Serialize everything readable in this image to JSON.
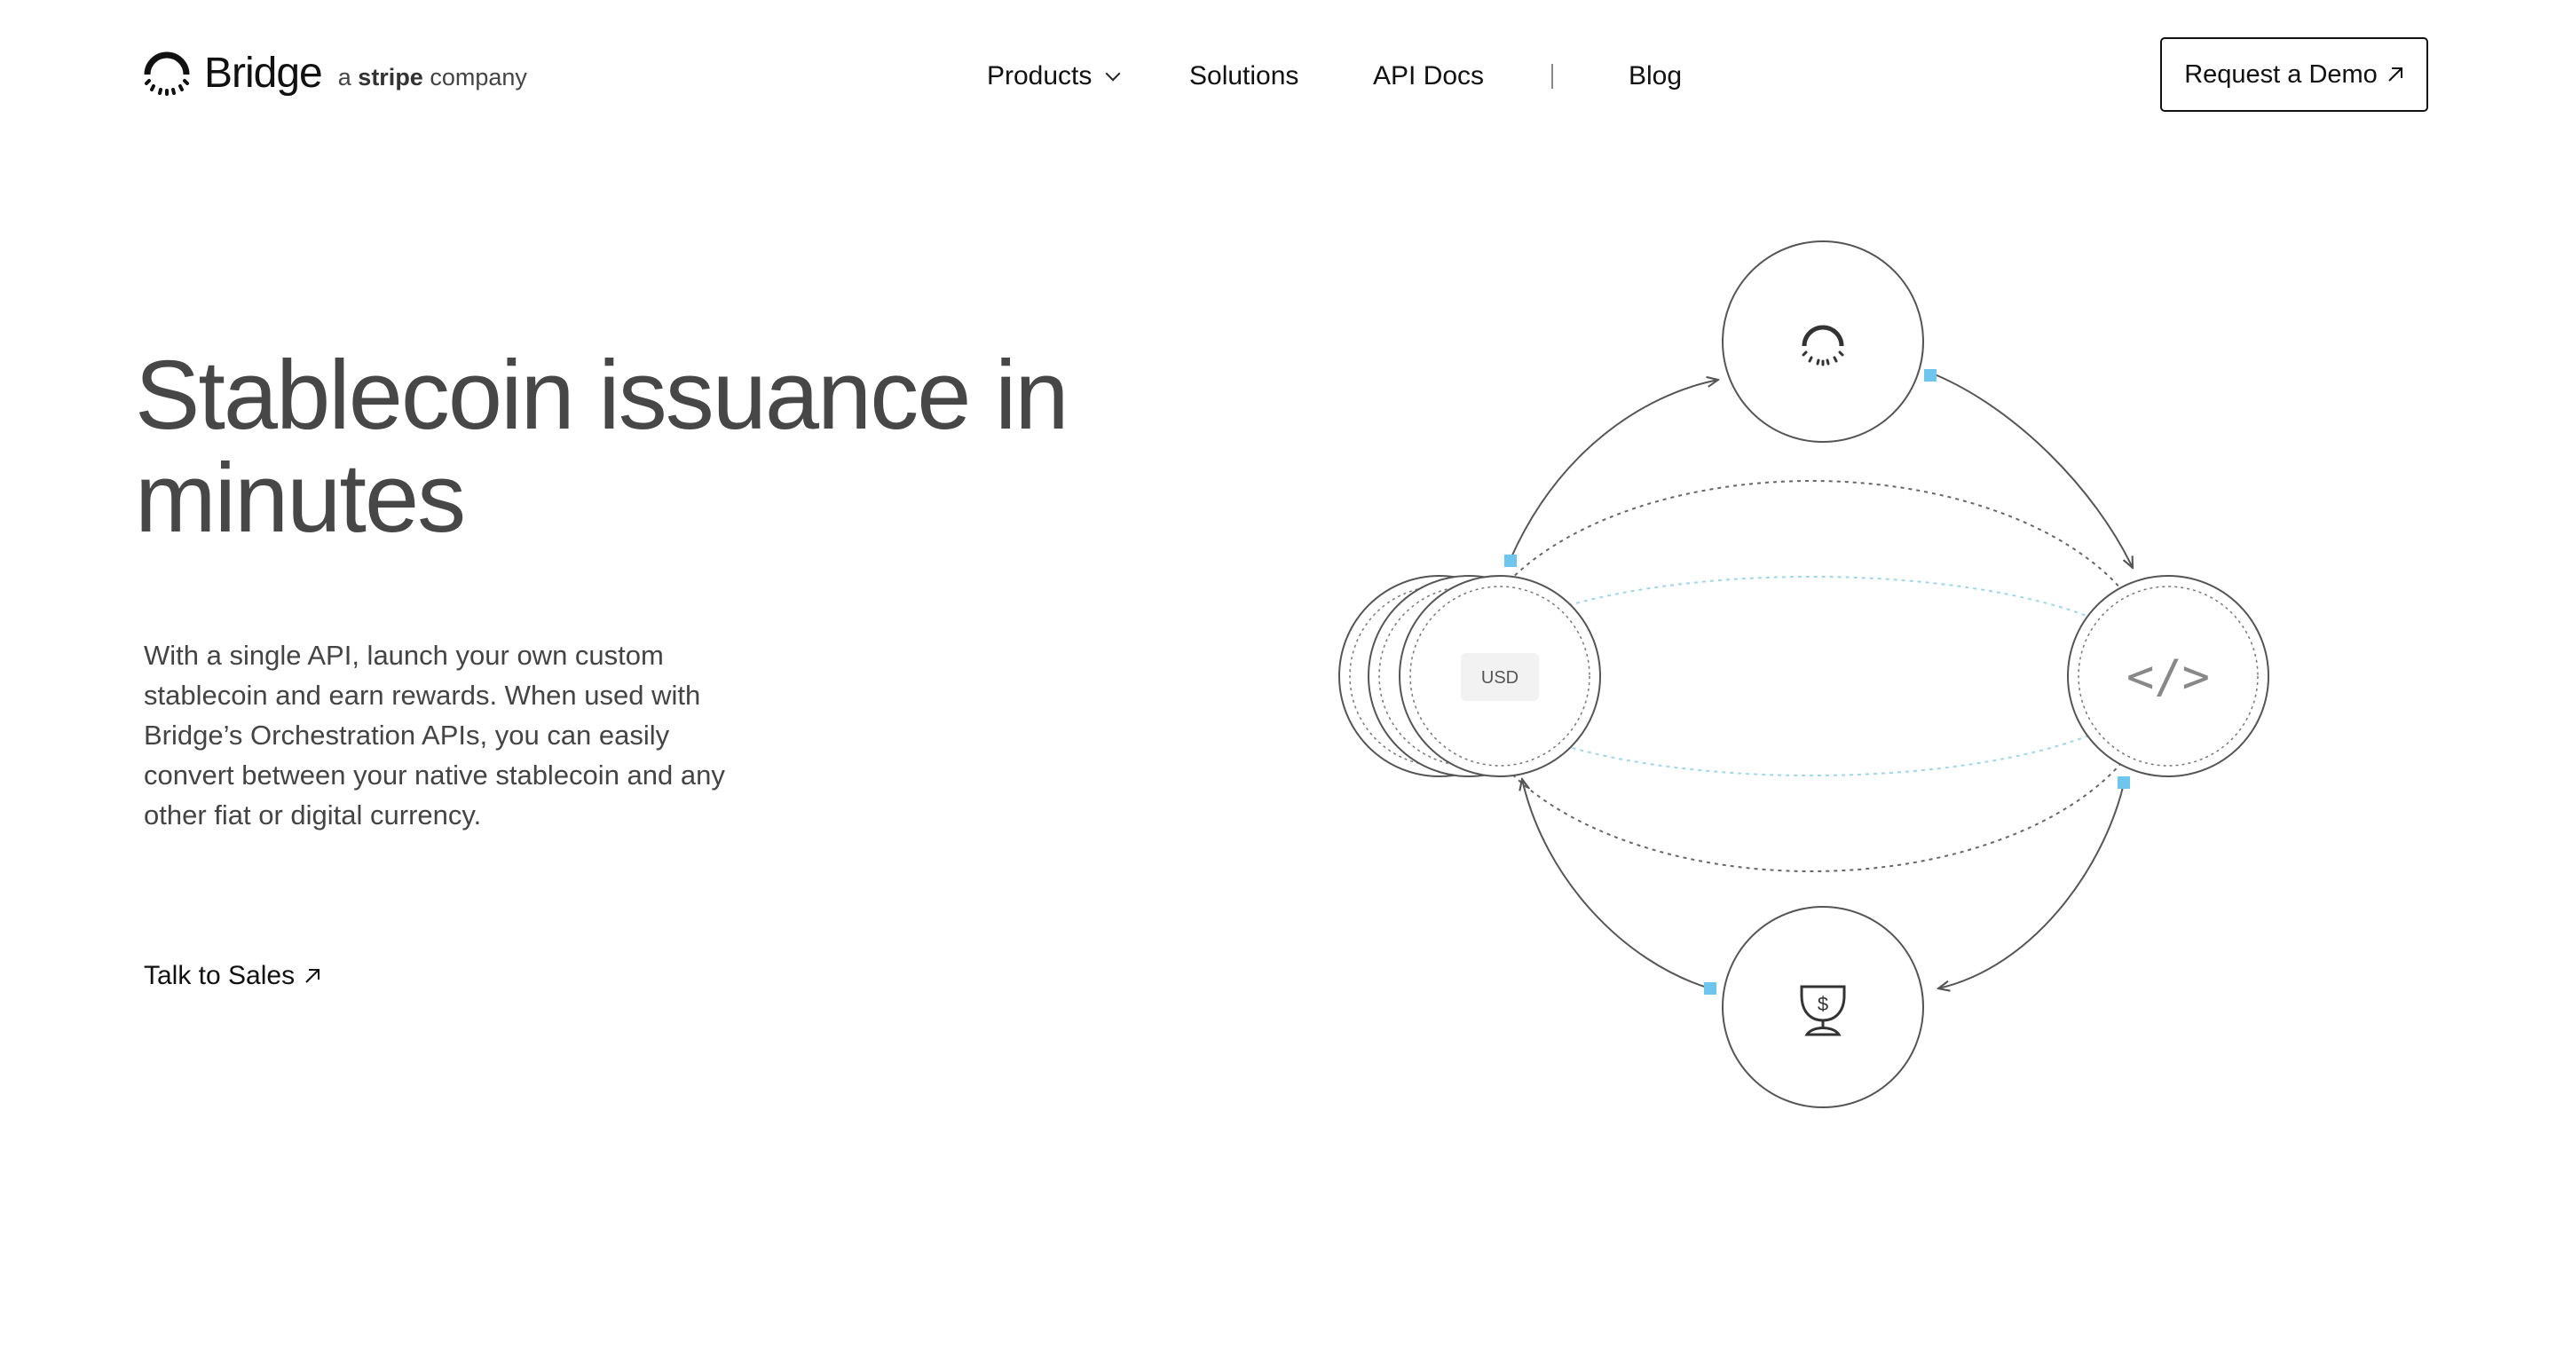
{
  "header": {
    "brand": "Bridge",
    "tagline_prefix": "a",
    "tagline_brand": "stripe",
    "tagline_suffix": "company",
    "nav": {
      "products": "Products",
      "solutions": "Solutions",
      "api_docs": "API Docs",
      "blog": "Blog"
    },
    "demo_button": "Request a Demo"
  },
  "hero": {
    "title_line1": "Stablecoin issuance in",
    "title_line2": "minutes",
    "description": "With a single API, launch your own custom stablecoin and earn rewards. When used with Bridge’s Orchestration APIs, you can easily convert between your native stablecoin and any other fiat or digital currency.",
    "cta": "Talk to Sales"
  },
  "diagram": {
    "usd_label": "USD",
    "code_label": "</>",
    "reward_symbol": "$",
    "colors": {
      "accent": "#6ec6ef",
      "stroke": "#555555",
      "inner_dash": "#9fd6e8"
    }
  }
}
